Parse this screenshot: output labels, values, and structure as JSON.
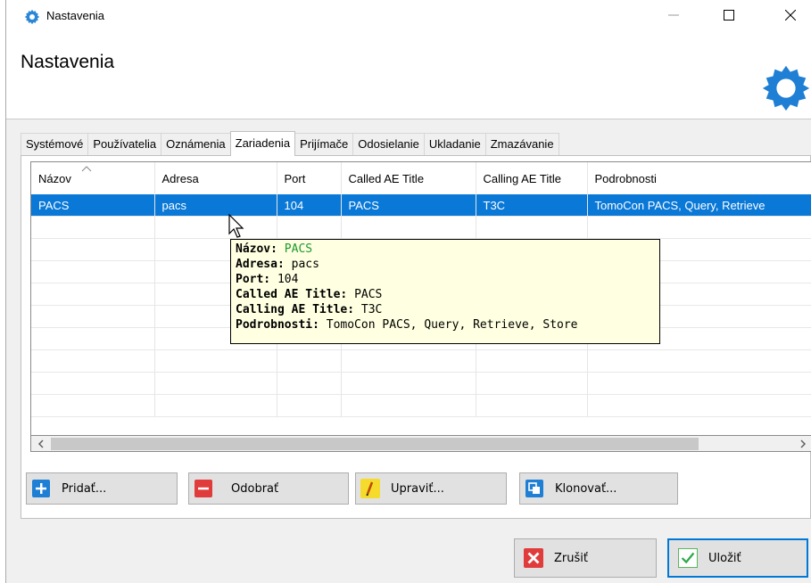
{
  "window": {
    "title": "Nastavenia",
    "icon": "gear-icon"
  },
  "header": {
    "title": "Nastavenia",
    "icon": "gear-icon"
  },
  "colors": {
    "selection": "#0a78d7",
    "tooltip_bg": "#ffffe1",
    "tooltip_value_green": "#1b9a2c",
    "accent": "#0078d7"
  },
  "tabs": [
    {
      "label": "Systémové"
    },
    {
      "label": "Používatelia"
    },
    {
      "label": "Oznámenia"
    },
    {
      "label": "Zariadenia",
      "active": true
    },
    {
      "label": "Prijímače"
    },
    {
      "label": "Odosielanie"
    },
    {
      "label": "Ukladanie"
    },
    {
      "label": "Zmazávanie"
    }
  ],
  "table": {
    "columns": [
      "Názov",
      "Adresa",
      "Port",
      "Called AE Title",
      "Calling AE Title",
      "Podrobnosti"
    ],
    "sorted_column": "Názov",
    "rows": [
      {
        "name": "PACS",
        "address": "pacs",
        "port": "104",
        "called": "PACS",
        "calling": "T3C",
        "details": "TomoCon PACS, Query, Retrieve",
        "selected": true
      }
    ]
  },
  "tooltip": {
    "lines": [
      {
        "key": "Názov:",
        "value": "PACS"
      },
      {
        "key": "Adresa:",
        "value": "pacs"
      },
      {
        "key": "Port:",
        "value": "104"
      },
      {
        "key": "Called AE Title:",
        "value": "PACS"
      },
      {
        "key": "Calling AE Title:",
        "value": "T3C"
      },
      {
        "key": "Podrobnosti:",
        "value": "TomoCon PACS, Query, Retrieve, Store"
      }
    ]
  },
  "buttons": {
    "add": {
      "label": "Pridať...",
      "icon": "plus-icon"
    },
    "remove": {
      "label": "Odobrať",
      "icon": "minus-icon"
    },
    "edit": {
      "label": "Upraviť...",
      "icon": "pencil-icon"
    },
    "clone": {
      "label": "Klonovať...",
      "icon": "clone-icon"
    },
    "cancel": {
      "label": "Zrušiť",
      "icon": "x-icon"
    },
    "save": {
      "label": "Uložiť",
      "icon": "checkmark-icon"
    }
  }
}
